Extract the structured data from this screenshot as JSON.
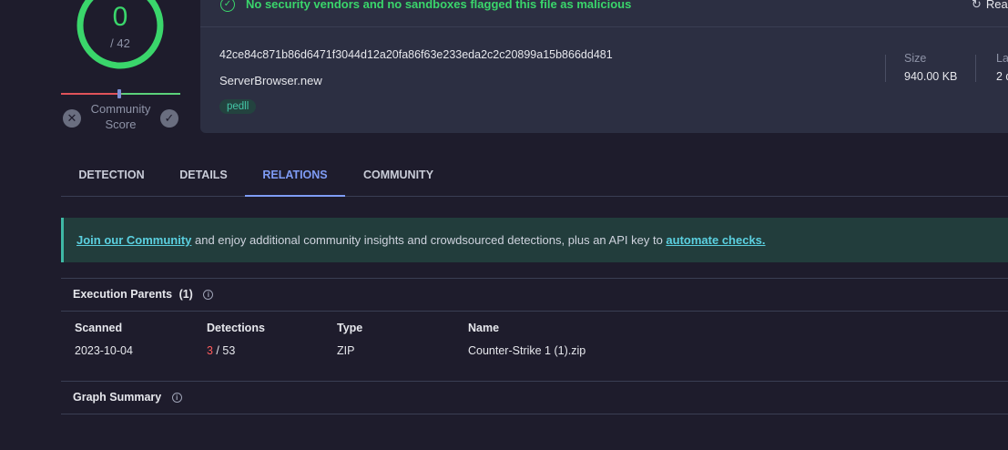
{
  "score": {
    "value": "0",
    "total": "/ 42",
    "color": "#3ad66b",
    "community_label": "Community Score",
    "community_line1": "Community",
    "community_line2": "Score"
  },
  "banner": {
    "status_text": "No security vendors and no sandboxes flagged this file as malicious",
    "reanalyze_label": "Rea",
    "hash": "42ce84c871b86d6471f3044d12a20fa86f63e233eda2c2c20899a15b866dd481",
    "filename": "ServerBrowser.new",
    "tag": "pedll",
    "size_label": "Size",
    "size_value": "940.00 KB",
    "last_label": "La",
    "last_value": "2 d"
  },
  "tabs": [
    {
      "label": "DETECTION",
      "active": false
    },
    {
      "label": "DETAILS",
      "active": false
    },
    {
      "label": "RELATIONS",
      "active": true
    },
    {
      "label": "COMMUNITY",
      "active": false
    }
  ],
  "notice": {
    "link1": "Join our Community",
    "middle": " and enjoy additional community insights and crowdsourced detections, plus an API key to ",
    "link2": "automate checks."
  },
  "execution_parents": {
    "title": "Execution Parents",
    "count": "(1)",
    "columns": [
      "Scanned",
      "Detections",
      "Type",
      "Name"
    ],
    "rows": [
      {
        "scanned": "2023-10-04",
        "detections_hit": "3",
        "detections_total": " / 53",
        "type": "ZIP",
        "name": "Counter-Strike 1 (1).zip"
      }
    ]
  },
  "graph_summary": {
    "title": "Graph Summary"
  }
}
